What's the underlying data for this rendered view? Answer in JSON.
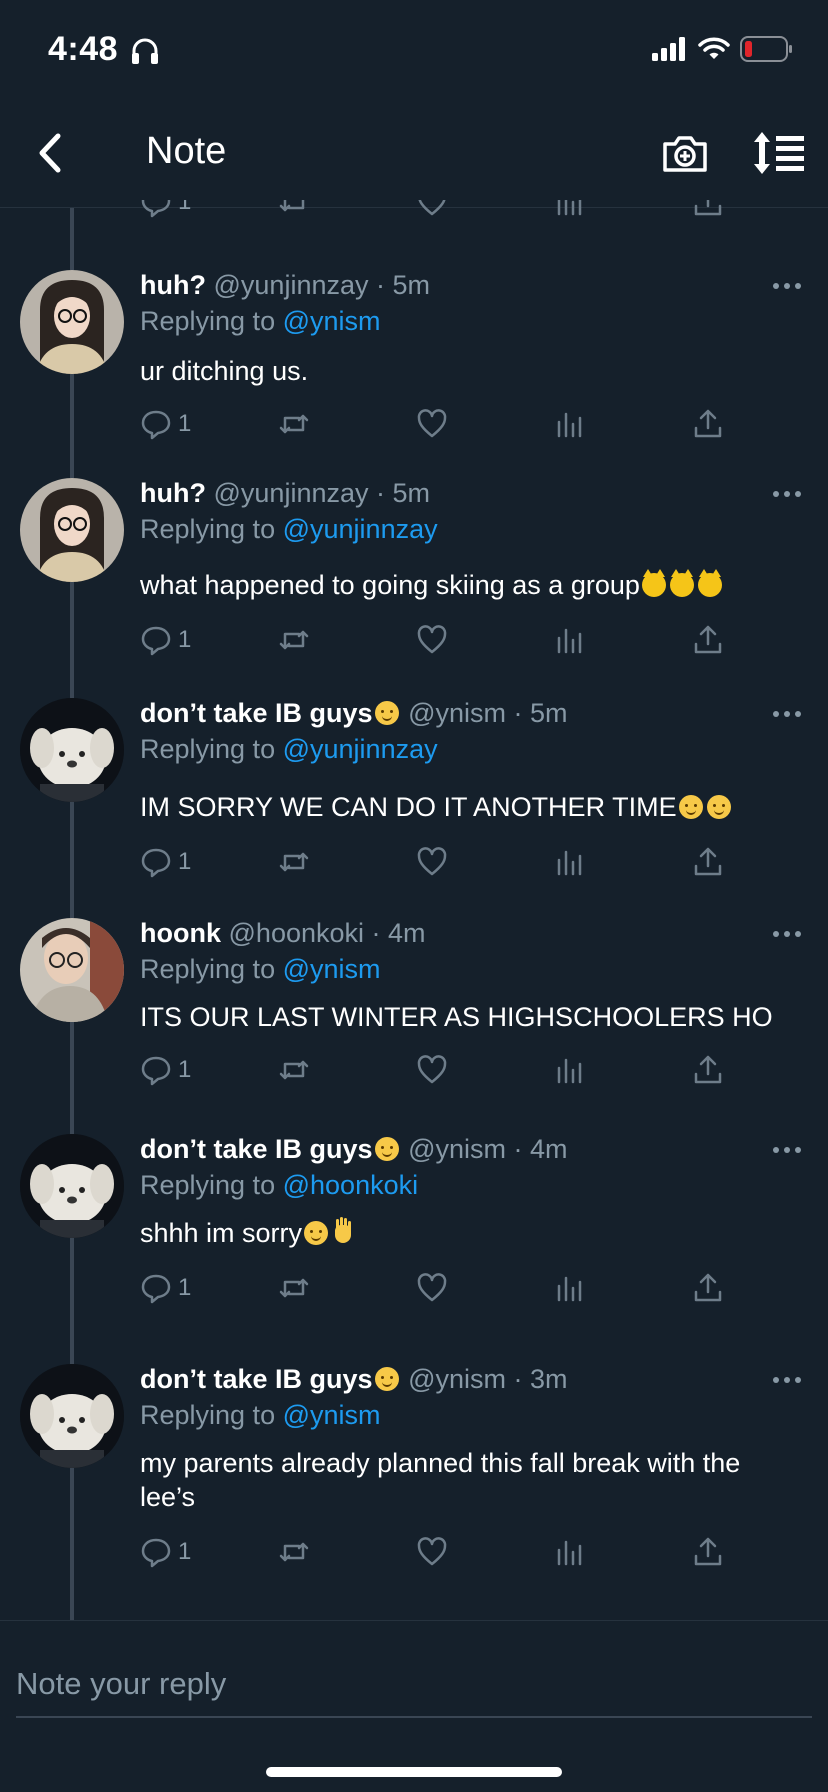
{
  "status_bar": {
    "time": "4:48",
    "icons": [
      "headphones-icon",
      "signal-icon",
      "wifi-icon",
      "battery-low-icon"
    ],
    "battery_color": "#e0252b"
  },
  "nav": {
    "title": "Note",
    "back_icon": "chevron-left-icon",
    "camera_icon": "camera-plus-icon",
    "sort_icon": "sort-list-icon"
  },
  "colors": {
    "background": "#15202b",
    "text": "#ffffff",
    "muted": "#8899a6",
    "link": "#1d9bf0",
    "divider": "#3a4654"
  },
  "top_partial_actions": {
    "reply_count": "1"
  },
  "tweets": [
    {
      "name": "huh?",
      "handle": "@yunjinnzay",
      "time": "· 5m",
      "replying_prefix": "Replying to",
      "replying_to": "@ynism",
      "text": "ur ditching us.",
      "reply_count": "1",
      "avatar": "girl-glasses-avatar"
    },
    {
      "name": "huh?",
      "handle": "@yunjinnzay",
      "time": "· 5m",
      "replying_prefix": "Replying to",
      "replying_to": "@yunjinnzay",
      "text": "what happened to going skiing as a group",
      "emojis": [
        "pouting-cat",
        "pouting-cat",
        "pouting-cat"
      ],
      "reply_count": "1",
      "avatar": "girl-glasses-avatar"
    },
    {
      "name": "don’t take IB guys",
      "name_emoji": "confounded-face",
      "handle": "@ynism",
      "time": "· 5m",
      "replying_prefix": "Replying to",
      "replying_to": "@yunjinnzay",
      "text": "IM SORRY WE CAN DO IT ANOTHER TIME",
      "emojis": [
        "pleading-face",
        "pleading-face"
      ],
      "reply_count": "1",
      "avatar": "plush-dog-avatar"
    },
    {
      "name": "hoonk",
      "handle": "@hoonkoki",
      "time": "· 4m",
      "replying_prefix": "Replying to",
      "replying_to": "@ynism",
      "text": "ITS OUR LAST WINTER AS HIGHSCHOOLERS HO",
      "reply_count": "1",
      "avatar": "boy-glasses-avatar"
    },
    {
      "name": "don’t take IB guys",
      "name_emoji": "confounded-face",
      "handle": "@ynism",
      "time": "· 4m",
      "replying_prefix": "Replying to",
      "replying_to": "@hoonkoki",
      "text": "shhh im sorry",
      "emojis": [
        "pensive-face",
        "raised-hand"
      ],
      "reply_count": "1",
      "avatar": "plush-dog-avatar"
    },
    {
      "name": "don’t take IB guys",
      "name_emoji": "confounded-face",
      "handle": "@ynism",
      "time": "· 3m",
      "replying_prefix": "Replying to",
      "replying_to": "@ynism",
      "text": "my parents already planned this fall break with the lee’s",
      "reply_count": "1",
      "avatar": "plush-dog-avatar"
    }
  ],
  "reply_bar": {
    "placeholder": "Note your reply"
  }
}
